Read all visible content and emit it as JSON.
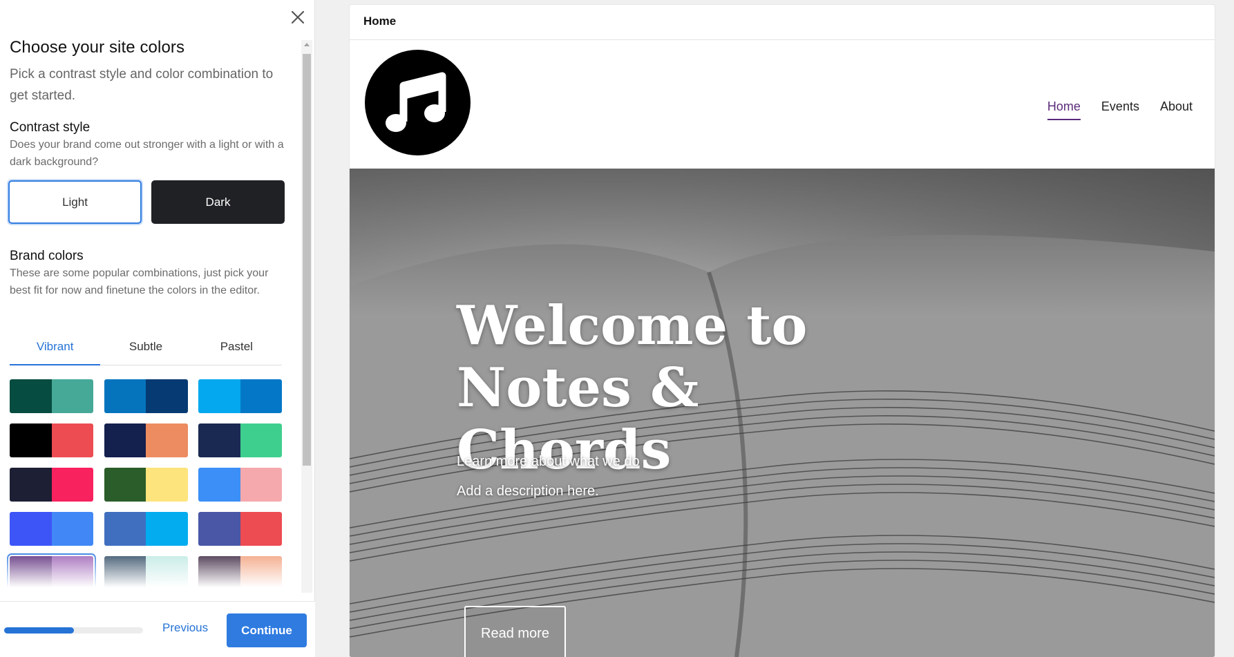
{
  "panel": {
    "title": "Choose your site colors",
    "subtitle": "Pick a contrast style and color combination to get started.",
    "contrast": {
      "title": "Contrast style",
      "description": "Does your brand come out stronger with a light or with a dark background?",
      "light_label": "Light",
      "dark_label": "Dark",
      "selected": "Light"
    },
    "brand": {
      "title": "Brand colors",
      "description": "These are some popular combinations, just pick your best fit for now and finetune the colors in the editor.",
      "tabs": [
        {
          "label": "Vibrant",
          "active": true
        },
        {
          "label": "Subtle",
          "active": false
        },
        {
          "label": "Pastel",
          "active": false
        }
      ],
      "swatches": [
        [
          "#064c40",
          "#46a997"
        ],
        [
          "#0574bd",
          "#063a73"
        ],
        [
          "#04a8ee",
          "#0478c6"
        ],
        [
          "#000000",
          "#ec4c52"
        ],
        [
          "#14204e",
          "#ec8c60"
        ],
        [
          "#1a2952",
          "#3ecf8e"
        ],
        [
          "#1d2034",
          "#f8225e"
        ],
        [
          "#2a5d2a",
          "#fde47d"
        ],
        [
          "#3b8ff6",
          "#f5a9ad"
        ],
        [
          "#3d55f7",
          "#4188f6"
        ],
        [
          "#416fc0",
          "#03acef"
        ],
        [
          "#4957a6",
          "#ec4c52"
        ],
        [
          "#5a2a7a",
          "#9d62b6"
        ],
        [
          "#2f4a63",
          "#bfe9e3"
        ],
        [
          "#3b2440",
          "#f2a07c"
        ]
      ],
      "selected_swatch": 12
    },
    "footer": {
      "progress": 0.5,
      "previous_label": "Previous",
      "continue_label": "Continue"
    }
  },
  "preview": {
    "page_name": "Home",
    "nav": [
      {
        "label": "Home",
        "active": true
      },
      {
        "label": "Events",
        "active": false
      },
      {
        "label": "About",
        "active": false
      }
    ],
    "logo_icon": "music-note-icon",
    "hero": {
      "title": "Welcome to Notes & Chords",
      "line1": "Learn more about what we do",
      "line2": "Add a description here.",
      "button_label": "Read more"
    }
  },
  "colors": {
    "accent": "#2f7be0",
    "nav_active": "#5a2a7a"
  }
}
